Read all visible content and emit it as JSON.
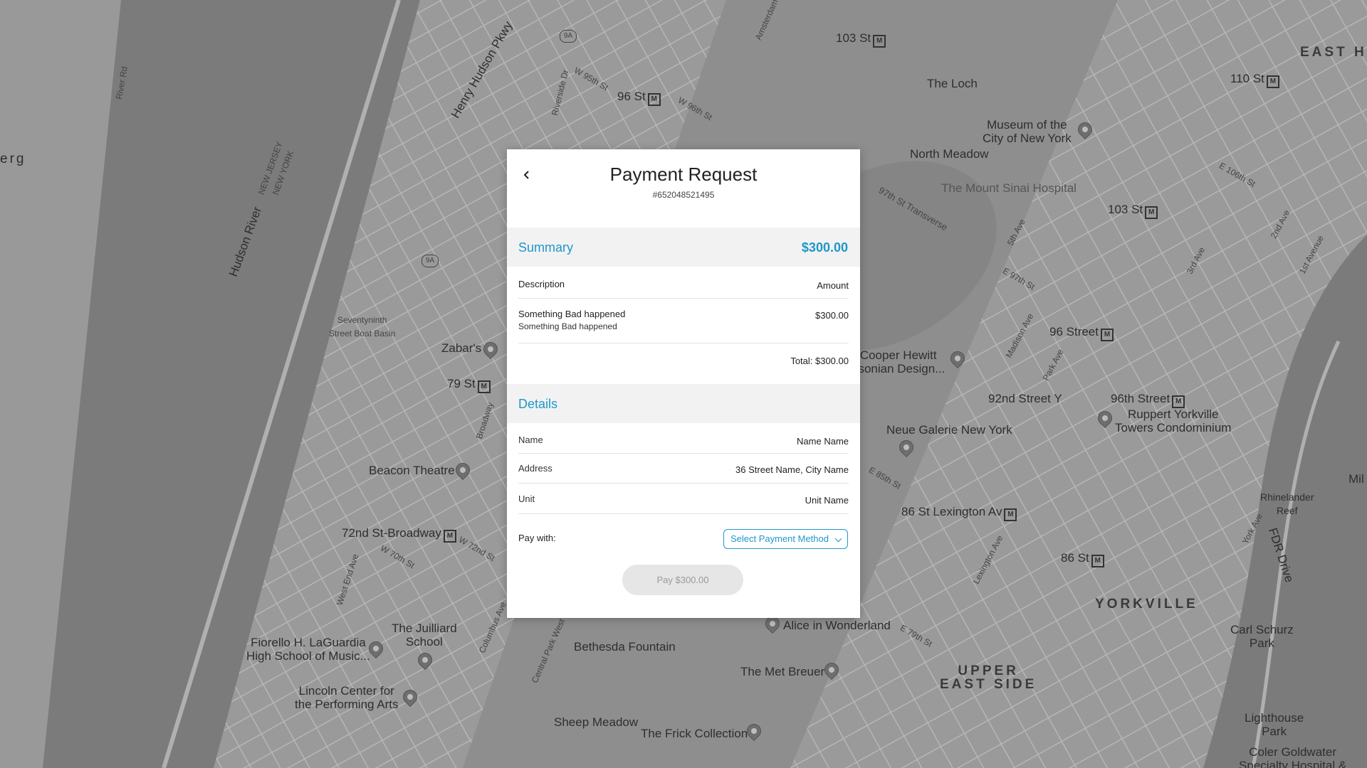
{
  "map": {
    "labels": {
      "loch": "The Loch",
      "museum_city": "Museum of the\nCity of New York",
      "north_meadow": "North Meadow",
      "mount_sinai": "The Mount Sinai Hospital",
      "st103_west": "103 St",
      "st103_east": "103 St",
      "st110": "110 St",
      "st96_west": "96 St",
      "east_harlem": "EAST H",
      "henry_hudson": "Henry Hudson Pkwy",
      "hudson_river": "Hudson River",
      "river_rd": "River Rd",
      "new_jersey": "NEW JERSEY\nNEW YORK",
      "zabars": "Zabar's",
      "boat_basin": "Seventyninth\nStreet Boat Basin",
      "st79": "79 St",
      "beacon": "Beacon Theatre",
      "st72": "72nd St-Broadway",
      "juilliard": "The Juilliard\nSchool",
      "laguardia": "Fiorello H. LaGuardia\nHigh School of Music...",
      "lincoln": "Lincoln Center for\nthe Performing Arts",
      "bethesda": "Bethesda Fountain",
      "sheep": "Sheep Meadow",
      "frick": "The Frick Collection",
      "met_breuer": "The Met Breuer",
      "alice": "Alice in Wonderland",
      "cooper": "Cooper Hewitt\nhsonian Design...",
      "neue": "Neue Galerie New York",
      "st92": "92nd Street Y",
      "st96_east": "96 Street",
      "st96th": "96th Street",
      "ruppert": "Ruppert Yorkville\nTowers Condominium",
      "st86_lex": "86 St Lexington Av",
      "st86": "86 St",
      "yorkville": "YORKVILLE",
      "upper_east": "UPPER\nEAST SIDE",
      "carl": "Carl Schurz\nPark",
      "rhinelander": "Rhinelander\nReef",
      "fdr": "FDR Drive",
      "lighthouse": "Lighthouse\nPark",
      "coler": "Coler Goldwater\nSpecialty Hospital &",
      "mil": "Mil",
      "erg": "erg",
      "transverse": "97th St Transverse",
      "madison": "Madison Ave",
      "park_ave": "Park Ave",
      "fifth_ave": "5th Ave",
      "lexington": "Lexington Ave",
      "broadway": "Broadway",
      "columbus": "Columbus Ave",
      "amsterdam": "Amsterdam Ave",
      "west_end": "West End Ave",
      "riverside": "Riverside Dr",
      "central_park_west": "Central Park West",
      "third_ave": "3rd Ave",
      "second_ave": "2nd Ave",
      "first_ave": "1st Avenue",
      "york_ave": "York Ave",
      "e79": "E 79th St",
      "e85": "E 85th St",
      "e97": "E 97th St",
      "e106": "E 106th St",
      "w95": "W 95th St",
      "w96": "W 96th St",
      "w72": "W 72nd St",
      "w70": "W 70th St",
      "metro_mark": "M",
      "hwy_9a": "9A"
    }
  },
  "modal": {
    "title": "Payment Request",
    "request_id": "#652048521495",
    "summary": {
      "label": "Summary",
      "amount": "$300.00",
      "col_description": "Description",
      "col_amount": "Amount",
      "items": [
        {
          "title": "Something Bad happened",
          "subtitle": "Something Bad happened",
          "amount": "$300.00"
        }
      ],
      "total": "Total: $300.00"
    },
    "details": {
      "label": "Details",
      "rows": [
        {
          "label": "Name",
          "value": "Name Name"
        },
        {
          "label": "Address",
          "value": "36 Street Name, City Name"
        },
        {
          "label": "Unit",
          "value": "Unit Name"
        }
      ]
    },
    "pay_with_label": "Pay with:",
    "payment_select_label": "Select Payment Method",
    "pay_button_label": "Pay $300.00"
  },
  "colors": {
    "accent": "#1e98c8",
    "section_bg": "#f2f2f2",
    "map_bg": "#8c8c8c",
    "pay_button_bg": "#e6e6e6"
  },
  "icons": {
    "back": "chevron-left-icon",
    "dropdown": "chevron-down-icon",
    "map_pin": "map-pin-icon",
    "metro": "metro-icon"
  }
}
